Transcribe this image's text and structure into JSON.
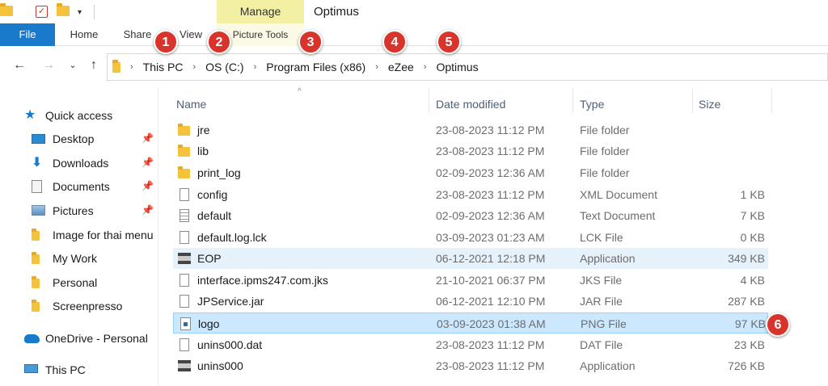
{
  "title_bar": {
    "manage_tab": "Manage",
    "window_title": "Optimus",
    "qat_dropdown": "▾"
  },
  "ribbon": {
    "tabs": [
      "File",
      "Home",
      "Share",
      "View",
      "Picture Tools"
    ]
  },
  "nav": {
    "back": "←",
    "forward": "→",
    "recent": "⌄",
    "up": "↑",
    "breadcrumb": [
      "This PC",
      "OS (C:)",
      "Program Files (x86)",
      "eZee",
      "Optimus"
    ],
    "separator": "›"
  },
  "badges": [
    "1",
    "2",
    "3",
    "4",
    "5",
    "6"
  ],
  "sidebar": {
    "items": [
      {
        "label": "Quick access",
        "icon": "star-icon"
      },
      {
        "label": "Desktop",
        "icon": "desktop-icon",
        "pinned": true
      },
      {
        "label": "Downloads",
        "icon": "download-icon",
        "pinned": true
      },
      {
        "label": "Documents",
        "icon": "document-icon",
        "pinned": true
      },
      {
        "label": "Pictures",
        "icon": "pictures-icon",
        "pinned": true
      },
      {
        "label": "Image for thai menu",
        "icon": "folder-icon"
      },
      {
        "label": "My Work",
        "icon": "folder-icon"
      },
      {
        "label": "Personal",
        "icon": "folder-icon"
      },
      {
        "label": "Screenpresso",
        "icon": "folder-icon"
      },
      {
        "label": "OneDrive - Personal",
        "icon": "cloud-icon"
      },
      {
        "label": "This PC",
        "icon": "computer-icon"
      }
    ],
    "pin_glyph": "📌"
  },
  "file_list": {
    "columns": [
      "Name",
      "Date modified",
      "Type",
      "Size"
    ],
    "sort_glyph": "^",
    "rows": [
      {
        "name": "jre",
        "date": "23-08-2023 11:12 PM",
        "type": "File folder",
        "size": "",
        "icon": "folder-icon"
      },
      {
        "name": "lib",
        "date": "23-08-2023 11:12 PM",
        "type": "File folder",
        "size": "",
        "icon": "folder-icon"
      },
      {
        "name": "print_log",
        "date": "02-09-2023 12:36 AM",
        "type": "File folder",
        "size": "",
        "icon": "folder-icon"
      },
      {
        "name": "config",
        "date": "23-08-2023 11:12 PM",
        "type": "XML Document",
        "size": "1 KB",
        "icon": "file-icon"
      },
      {
        "name": "default",
        "date": "02-09-2023 12:36 AM",
        "type": "Text Document",
        "size": "7 KB",
        "icon": "text-file-icon"
      },
      {
        "name": "default.log.lck",
        "date": "03-09-2023 01:23 AM",
        "type": "LCK File",
        "size": "0 KB",
        "icon": "file-icon"
      },
      {
        "name": "EOP",
        "date": "06-12-2021 12:18 PM",
        "type": "Application",
        "size": "349 KB",
        "icon": "application-icon",
        "state": "hover"
      },
      {
        "name": "interface.ipms247.com.jks",
        "date": "21-10-2021 06:37 PM",
        "type": "JKS File",
        "size": "4 KB",
        "icon": "file-icon"
      },
      {
        "name": "JPService.jar",
        "date": "06-12-2021 12:10 PM",
        "type": "JAR File",
        "size": "287 KB",
        "icon": "file-icon"
      },
      {
        "name": "logo",
        "date": "03-09-2023 01:38 AM",
        "type": "PNG File",
        "size": "97 KB",
        "icon": "png-file-icon",
        "state": "selected"
      },
      {
        "name": "unins000.dat",
        "date": "23-08-2023 11:12 PM",
        "type": "DAT File",
        "size": "23 KB",
        "icon": "file-icon"
      },
      {
        "name": "unins000",
        "date": "23-08-2023 11:12 PM",
        "type": "Application",
        "size": "726 KB",
        "icon": "application-icon"
      }
    ]
  }
}
